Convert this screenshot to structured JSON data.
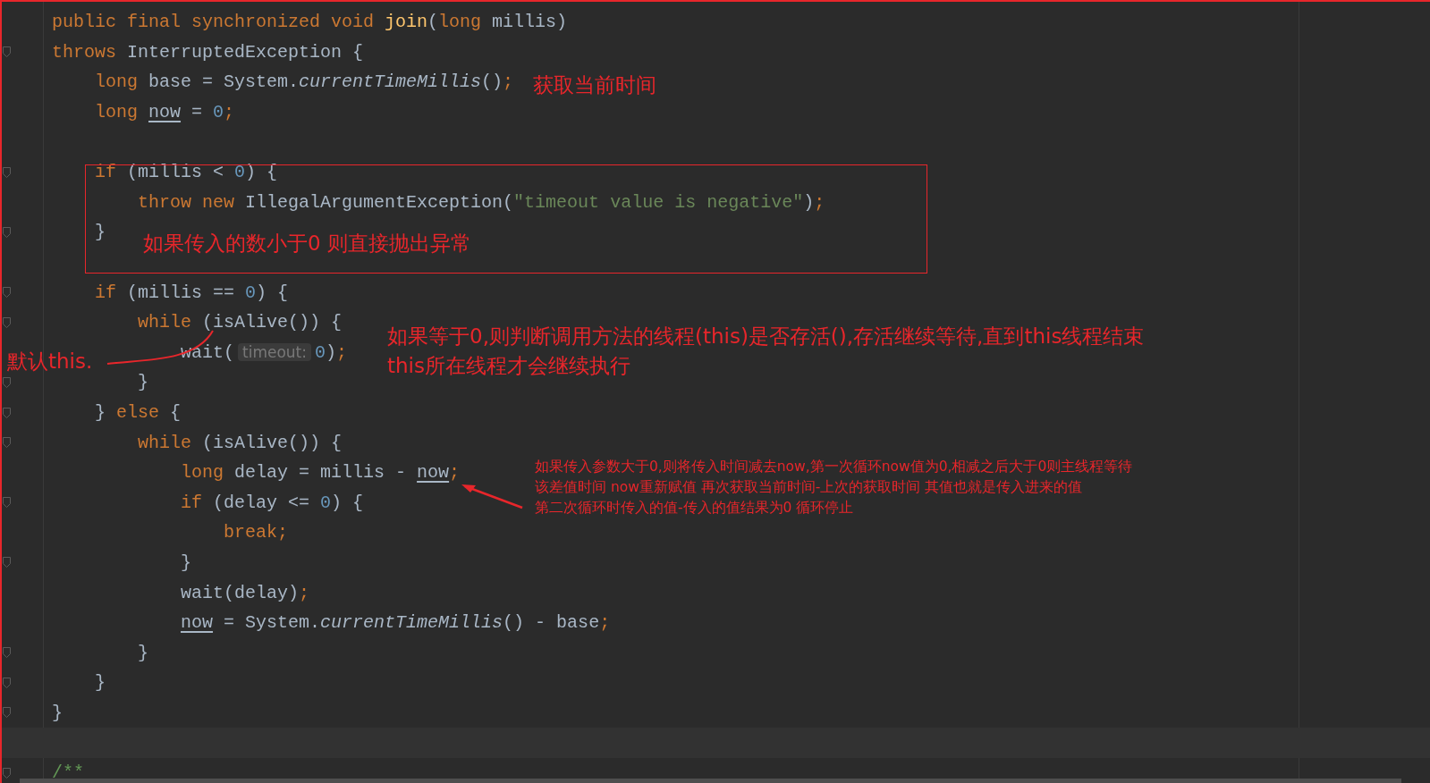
{
  "editor": {
    "lines": [
      {
        "fold": false,
        "tokens": [
          {
            "text": "public final synchronized void ",
            "kind": "kw"
          },
          {
            "text": "join",
            "kind": "fn"
          },
          {
            "text": "(",
            "kind": "plain"
          },
          {
            "text": "long ",
            "kind": "kw"
          },
          {
            "text": "millis)",
            "kind": "plain"
          }
        ]
      },
      {
        "fold": true,
        "tokens": [
          {
            "text": "throws ",
            "kind": "kw"
          },
          {
            "text": "InterruptedException {",
            "kind": "plain"
          }
        ]
      },
      {
        "fold": false,
        "tokens": [
          {
            "text": "long ",
            "kind": "kw"
          },
          {
            "text": "base = System.",
            "kind": "plain"
          },
          {
            "text": "currentTimeMillis",
            "kind": "static"
          },
          {
            "text": "()",
            "kind": "plain"
          },
          {
            "text": ";",
            "kind": "kw"
          }
        ]
      },
      {
        "fold": false,
        "tokens": [
          {
            "text": "long ",
            "kind": "kw"
          },
          {
            "text": "now",
            "kind": "var"
          },
          {
            "text": " = ",
            "kind": "plain"
          },
          {
            "text": "0",
            "kind": "num"
          },
          {
            "text": ";",
            "kind": "kw"
          }
        ]
      },
      {
        "fold": false
      },
      {
        "fold": true,
        "tokens": [
          {
            "text": "if ",
            "kind": "kw"
          },
          {
            "text": "(millis < ",
            "kind": "plain"
          },
          {
            "text": "0",
            "kind": "num"
          },
          {
            "text": ") {",
            "kind": "plain"
          }
        ]
      },
      {
        "fold": false,
        "tokens": [
          {
            "text": "throw new ",
            "kind": "kw"
          },
          {
            "text": "IllegalArgumentException(",
            "kind": "plain"
          },
          {
            "text": "\"timeout value is negative\"",
            "kind": "str"
          },
          {
            "text": ")",
            "kind": "plain"
          },
          {
            "text": ";",
            "kind": "kw"
          }
        ]
      },
      {
        "fold": true,
        "tokens": [
          {
            "text": "}",
            "kind": "plain"
          }
        ]
      },
      {
        "fold": false
      },
      {
        "fold": true,
        "tokens": [
          {
            "text": "if ",
            "kind": "kw"
          },
          {
            "text": "(millis == ",
            "kind": "plain"
          },
          {
            "text": "0",
            "kind": "num"
          },
          {
            "text": ") {",
            "kind": "plain"
          }
        ]
      },
      {
        "fold": true,
        "tokens": [
          {
            "text": "while ",
            "kind": "kw"
          },
          {
            "text": "(isAlive()) {",
            "kind": "plain"
          }
        ]
      },
      {
        "fold": false,
        "tokens": [
          {
            "text": "wait(",
            "kind": "plain"
          },
          {
            "text": "timeout:",
            "kind": "hint"
          },
          {
            "text": "0",
            "kind": "num"
          },
          {
            "text": ")",
            "kind": "plain"
          },
          {
            "text": ";",
            "kind": "kw"
          }
        ]
      },
      {
        "fold": true,
        "tokens": [
          {
            "text": "}",
            "kind": "plain"
          }
        ]
      },
      {
        "fold": true,
        "tokens": [
          {
            "text": "} ",
            "kind": "plain"
          },
          {
            "text": "else ",
            "kind": "kw"
          },
          {
            "text": "{",
            "kind": "plain"
          }
        ]
      },
      {
        "fold": true,
        "tokens": [
          {
            "text": "while ",
            "kind": "kw"
          },
          {
            "text": "(isAlive()) {",
            "kind": "plain"
          }
        ]
      },
      {
        "fold": false,
        "tokens": [
          {
            "text": "long ",
            "kind": "kw"
          },
          {
            "text": "delay = millis - ",
            "kind": "plain"
          },
          {
            "text": "now",
            "kind": "var"
          },
          {
            "text": ";",
            "kind": "kw"
          }
        ]
      },
      {
        "fold": true,
        "tokens": [
          {
            "text": "if ",
            "kind": "kw"
          },
          {
            "text": "(delay <= ",
            "kind": "plain"
          },
          {
            "text": "0",
            "kind": "num"
          },
          {
            "text": ") {",
            "kind": "plain"
          }
        ]
      },
      {
        "fold": false,
        "tokens": [
          {
            "text": "break;",
            "kind": "kw"
          }
        ]
      },
      {
        "fold": true,
        "tokens": [
          {
            "text": "}",
            "kind": "plain"
          }
        ]
      },
      {
        "fold": false,
        "tokens": [
          {
            "text": "wait(delay)",
            "kind": "plain"
          },
          {
            "text": ";",
            "kind": "kw"
          }
        ]
      },
      {
        "fold": false,
        "tokens": [
          {
            "text": "now",
            "kind": "var"
          },
          {
            "text": " = System.",
            "kind": "plain"
          },
          {
            "text": "currentTimeMillis",
            "kind": "static"
          },
          {
            "text": "() - base",
            "kind": "plain"
          },
          {
            "text": ";",
            "kind": "kw"
          }
        ]
      },
      {
        "fold": true,
        "tokens": [
          {
            "text": "}",
            "kind": "plain"
          }
        ]
      },
      {
        "fold": true,
        "tokens": [
          {
            "text": "}",
            "kind": "plain"
          }
        ]
      },
      {
        "fold": true,
        "tokens": [
          {
            "text": "}",
            "kind": "plain"
          }
        ]
      },
      {
        "fold": false
      },
      {
        "fold": true,
        "tokens": [
          {
            "text": "/**",
            "kind": "comment"
          }
        ]
      }
    ]
  },
  "annotations": {
    "time_note": "获取当前时间",
    "box_note": "如果传入的数小于0  则直接抛出异常",
    "loop_note": [
      "如果等于0,则判断调用方法的线程(this)是否存活(),存活继续等待,直到this线程结束",
      "this所在线程才会继续执行"
    ],
    "default_note": "默认this.",
    "remainder_note": [
      "如果传入参数大于0,则将传入时间减去now,第一次循环now值为0,相减之后大于0则主线程等待",
      "该差值时间  now重新赋值  再次获取当前时间-上次的获取时间  其值也就是传入进来的值",
      "第二次循环时传入的值-传入的值结果为0  循环停止"
    ]
  }
}
